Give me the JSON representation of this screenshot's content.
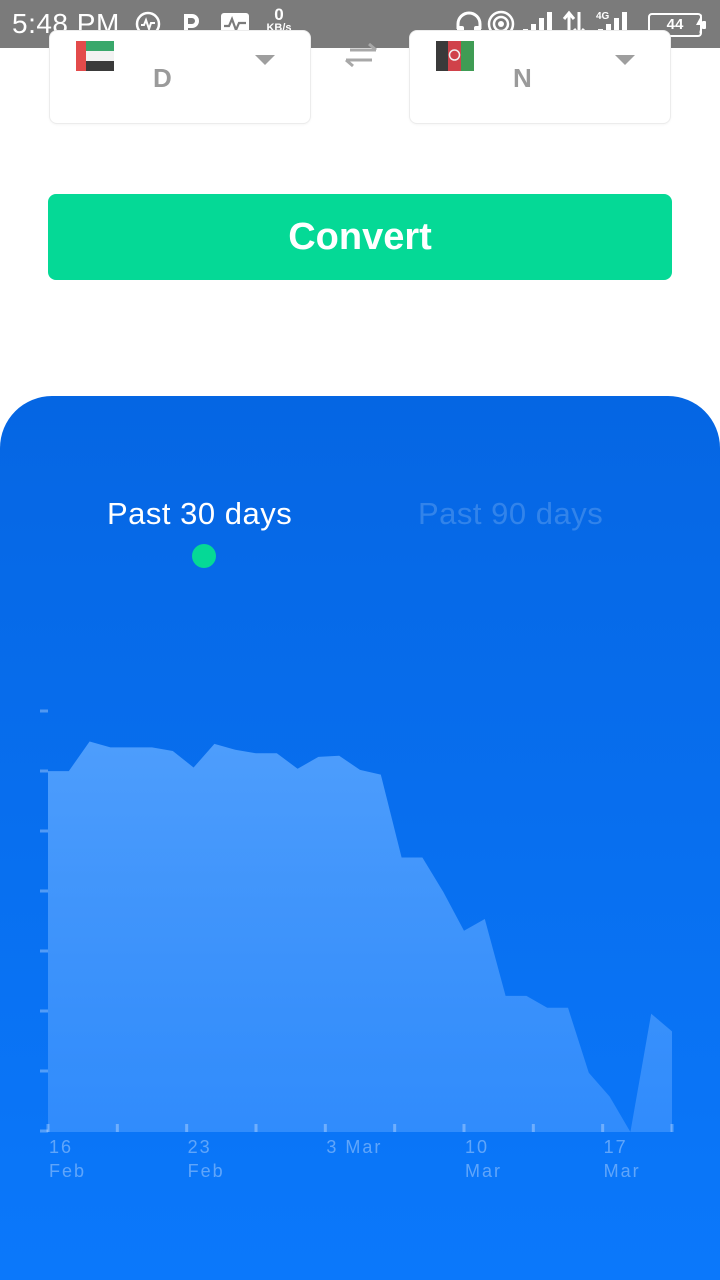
{
  "status_bar": {
    "time": "5:48 PM",
    "net_speed_value": "0",
    "net_speed_unit": "KB/s",
    "network_type": "4G",
    "battery": "44"
  },
  "converter": {
    "from_currency_code": "D",
    "to_currency_code": "N",
    "convert_label": "Convert"
  },
  "chart_tabs": {
    "active_label": "Past 30 days",
    "inactive_label": "Past 90 days"
  },
  "chart_data": {
    "type": "area",
    "x_tick_labels": [
      [
        "16",
        "Feb"
      ],
      [
        "23",
        "Feb"
      ],
      [
        "3 Mar",
        ""
      ],
      [
        "10",
        "Mar"
      ],
      [
        "17",
        "Mar"
      ]
    ],
    "x": [
      0,
      1,
      2,
      3,
      4,
      5,
      6,
      7,
      8,
      9,
      10,
      11,
      12,
      13,
      14,
      15,
      16,
      17,
      18,
      19,
      20,
      21,
      22,
      23,
      24,
      25,
      26,
      27,
      28,
      29,
      30
    ],
    "values": [
      6.45,
      6.45,
      6.7,
      6.65,
      6.65,
      6.65,
      6.62,
      6.48,
      6.68,
      6.63,
      6.6,
      6.6,
      6.47,
      6.57,
      6.58,
      6.46,
      6.42,
      5.72,
      5.72,
      5.43,
      5.1,
      5.2,
      4.55,
      4.55,
      4.45,
      4.45,
      3.9,
      3.7,
      3.4,
      4.4,
      4.25
    ],
    "ylim": [
      3.4,
      7.0
    ],
    "grid": false,
    "color": "#4a9bff"
  },
  "colors": {
    "accent_green": "#05d996",
    "panel_blue_top": "#0566e3",
    "panel_blue_bottom": "#0b78fb",
    "status_bar": "#7b7b7b"
  }
}
